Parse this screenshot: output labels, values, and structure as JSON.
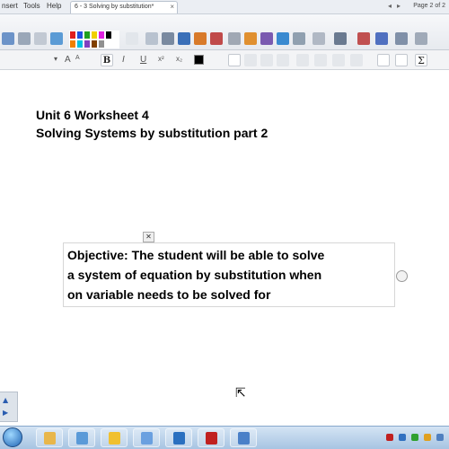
{
  "menubar": {
    "items": [
      "nsert",
      "Tools",
      "Help"
    ],
    "tab_title": "6 - 3 Solving by substitution*",
    "tab_close": "×",
    "nav_prev": "◂",
    "nav_next": "▸",
    "page_indicator": "Page 2 of 2"
  },
  "toolbar": {
    "palette_colors": [
      "#e01e1e",
      "#2050e0",
      "#20a020",
      "#f0d000",
      "#e020e0",
      "#000000",
      "#ffffff",
      "#f08000",
      "#00c0e0",
      "#8040c0",
      "#804000",
      "#909090",
      "#ffffff",
      "#ffffff"
    ],
    "undo_icon": "undo-icon",
    "redo_icon": "redo-icon"
  },
  "format_bar": {
    "font_size_dropdown": "▾",
    "grow_label": "A",
    "shrink_label": "A",
    "bold_label": "B",
    "italic_label": "I",
    "underline_label": "U",
    "superscript_label": "x²",
    "subscript_label": "x₂",
    "text_color": "#000000"
  },
  "canvas": {
    "title_line1": "Unit 6 Worksheet 4",
    "title_line2": "Solving Systems by substitution part 2",
    "objective_line1": "Objective: The student will be able to solve",
    "objective_line2": "a system of equation by substitution when",
    "objective_line3": "on variable needs to be solved for",
    "box_close": "✕",
    "cursor_glyph": "⇱"
  },
  "taskbar": {
    "app_colors": [
      "#e8b64a",
      "#5a9ad8",
      "#f0c030",
      "#6aa0e0",
      "#2a70c0",
      "#c02020",
      "#4a80c8"
    ],
    "tray_colors": [
      "#c02020",
      "#3070c0",
      "#30a030",
      "#e0a020",
      "#5080c0"
    ]
  }
}
